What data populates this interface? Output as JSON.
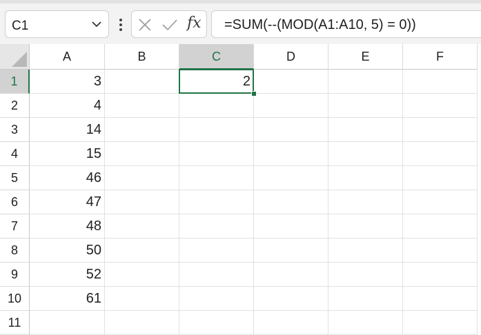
{
  "namebox": {
    "value": "C1"
  },
  "formula_bar": {
    "formula": "=SUM(--(MOD(A1:A10, 5) = 0))",
    "insert_function_label": "fx"
  },
  "columns": [
    "A",
    "B",
    "C",
    "D",
    "E",
    "F"
  ],
  "rows": [
    "1",
    "2",
    "3",
    "4",
    "5",
    "6",
    "7",
    "8",
    "9",
    "10",
    "11"
  ],
  "cells": {
    "A1": "3",
    "A2": "4",
    "A3": "14",
    "A4": "15",
    "A5": "46",
    "A6": "47",
    "A7": "48",
    "A8": "50",
    "A9": "52",
    "A10": "61",
    "C1": "2"
  },
  "selection": {
    "active_cell": "C1",
    "active_column": "C",
    "active_row": "1"
  },
  "colors": {
    "accent": "#217346",
    "header_active_bg": "#d2d2d2"
  },
  "icons": {
    "namebox_dropdown": "chevron-down-icon",
    "grip": "vertical-ellipsis-icon",
    "cancel": "close-icon",
    "enter": "checkmark-icon",
    "insert_function": "fx-icon"
  }
}
